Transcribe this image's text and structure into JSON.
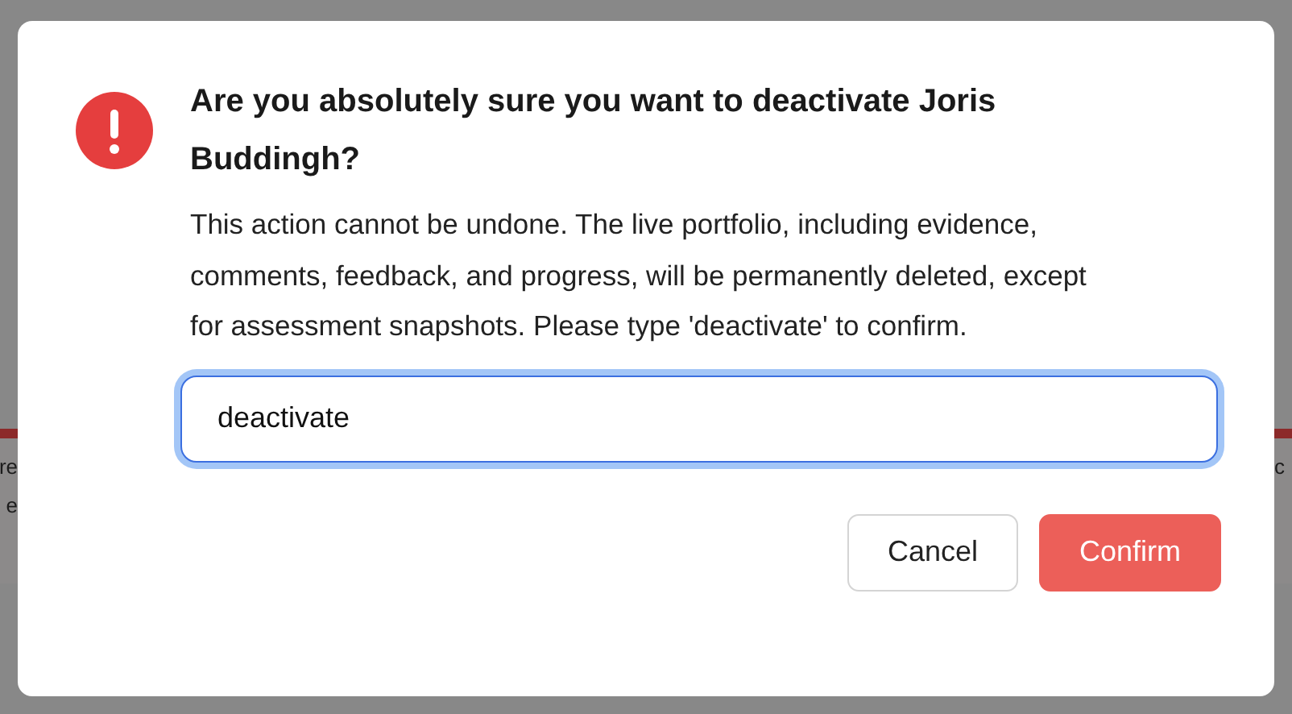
{
  "background": {
    "left_fragments": [
      "re",
      "e"
    ],
    "right_fragments": [
      "c"
    ]
  },
  "dialog": {
    "title": "Are you absolutely sure you want to deactivate Joris Buddingh?",
    "message": "This action cannot be undone. The live portfolio, including evidence, comments, feedback, and progress, will be permanently deleted, except for assessment snapshots. Please type 'deactivate' to confirm.",
    "input": {
      "value": "deactivate",
      "focused": true
    },
    "buttons": [
      {
        "label": "Cancel",
        "kind": "secondary"
      },
      {
        "label": "Confirm",
        "kind": "primary"
      }
    ]
  }
}
